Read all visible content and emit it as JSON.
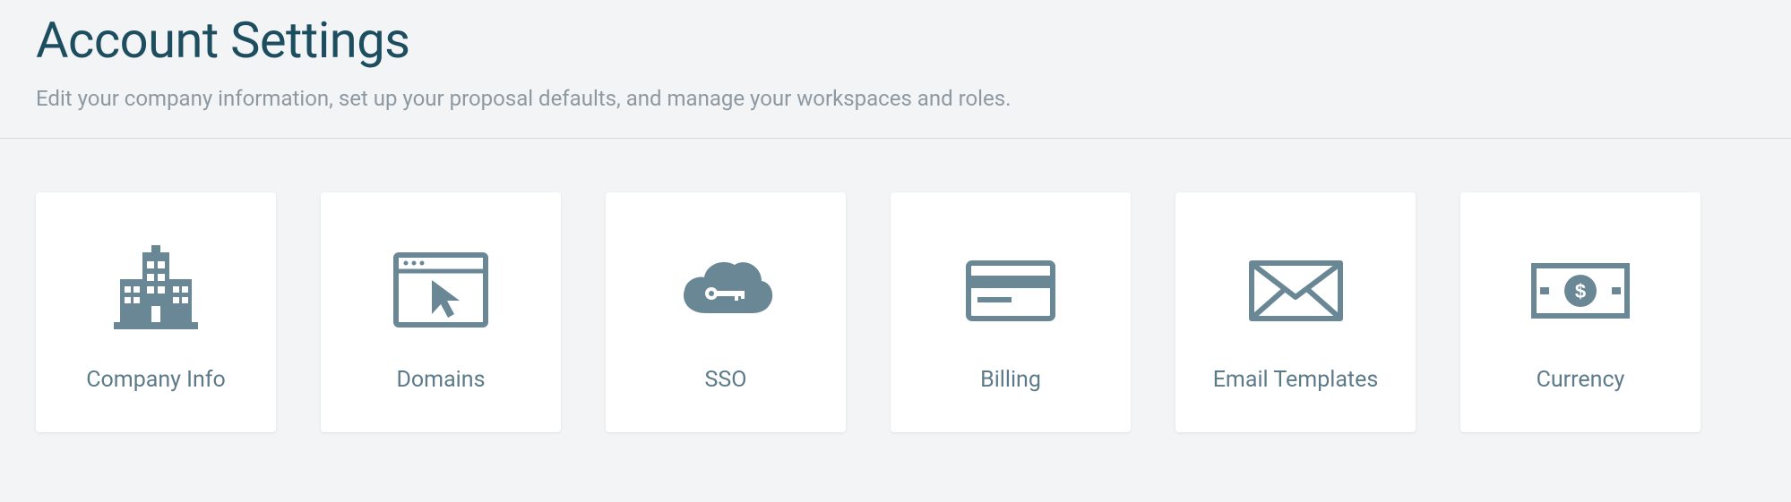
{
  "header": {
    "title": "Account Settings",
    "subtitle": "Edit your company information, set up your proposal defaults, and manage your workspaces and roles."
  },
  "cards": [
    {
      "label": "Company Info",
      "icon": "building-icon"
    },
    {
      "label": "Domains",
      "icon": "browser-pointer-icon"
    },
    {
      "label": "SSO",
      "icon": "cloud-key-icon"
    },
    {
      "label": "Billing",
      "icon": "credit-card-icon"
    },
    {
      "label": "Email Templates",
      "icon": "envelope-icon"
    },
    {
      "label": "Currency",
      "icon": "money-bill-icon"
    }
  ],
  "colors": {
    "icon": "#6a8796",
    "title": "#1d4e5f",
    "subtitle": "#8d99a2"
  }
}
